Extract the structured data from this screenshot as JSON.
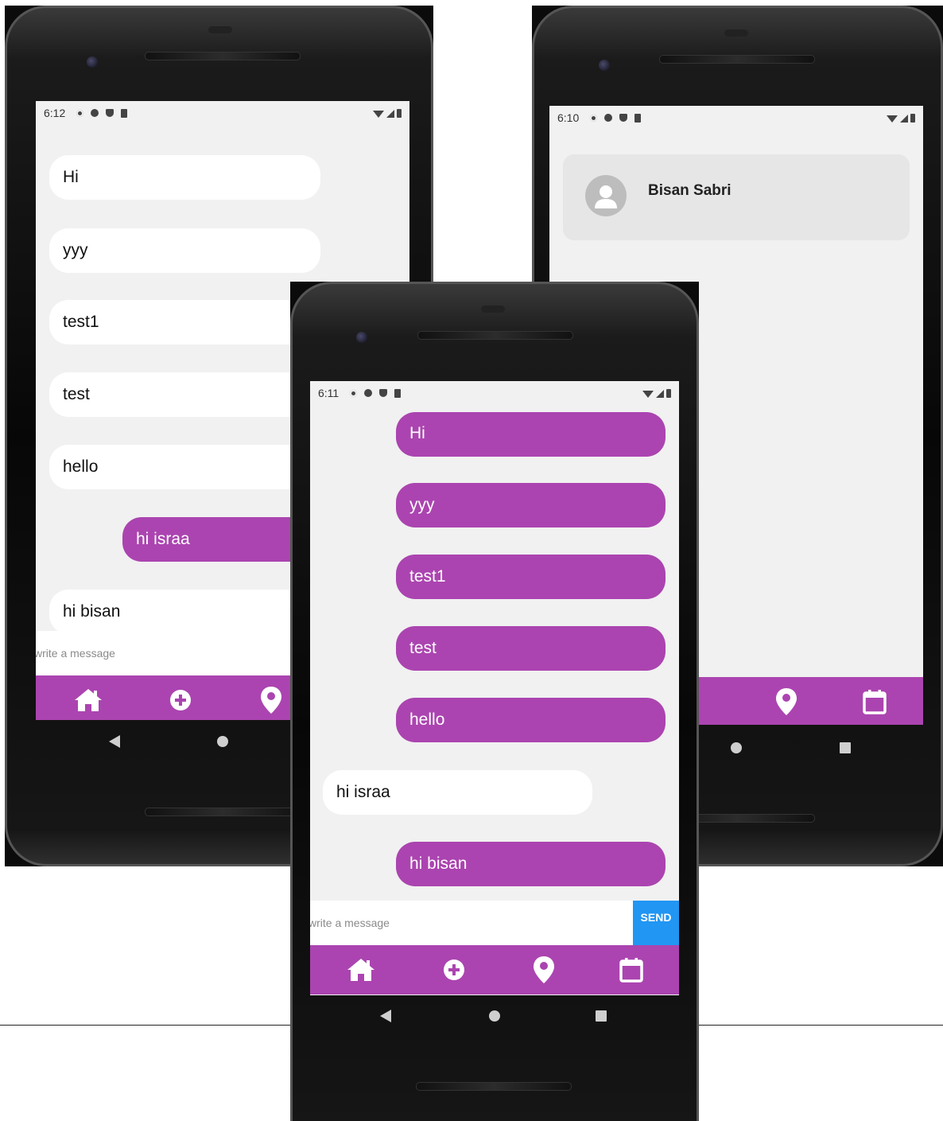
{
  "phones": {
    "left": {
      "time": "6:12",
      "messages": [
        {
          "text": "Hi",
          "dir": "in"
        },
        {
          "text": "yyy",
          "dir": "in"
        },
        {
          "text": "test1",
          "dir": "in"
        },
        {
          "text": "test",
          "dir": "in"
        },
        {
          "text": "hello",
          "dir": "in"
        },
        {
          "text": "hi israa",
          "dir": "out"
        },
        {
          "text": "hi bisan",
          "dir": "in"
        }
      ],
      "input_placeholder": "write a message"
    },
    "middle": {
      "time": "6:11",
      "messages": [
        {
          "text": "Hi",
          "dir": "out"
        },
        {
          "text": "yyy",
          "dir": "out"
        },
        {
          "text": "test1",
          "dir": "out"
        },
        {
          "text": "test",
          "dir": "out"
        },
        {
          "text": "hello",
          "dir": "out"
        },
        {
          "text": "hi israa",
          "dir": "in"
        },
        {
          "text": "hi bisan",
          "dir": "out"
        }
      ],
      "input_placeholder": "write a message",
      "send_label": "SEND"
    },
    "right": {
      "time": "6:10",
      "contact_name": "Bisan Sabri"
    }
  },
  "nav_items": [
    {
      "icon": "home-icon"
    },
    {
      "icon": "add-circle-icon"
    },
    {
      "icon": "location-pin-icon"
    },
    {
      "icon": "calendar-icon"
    }
  ],
  "colors": {
    "accent": "#ab44b0",
    "send": "#2196f3",
    "screen_bg": "#f1f1f1"
  }
}
